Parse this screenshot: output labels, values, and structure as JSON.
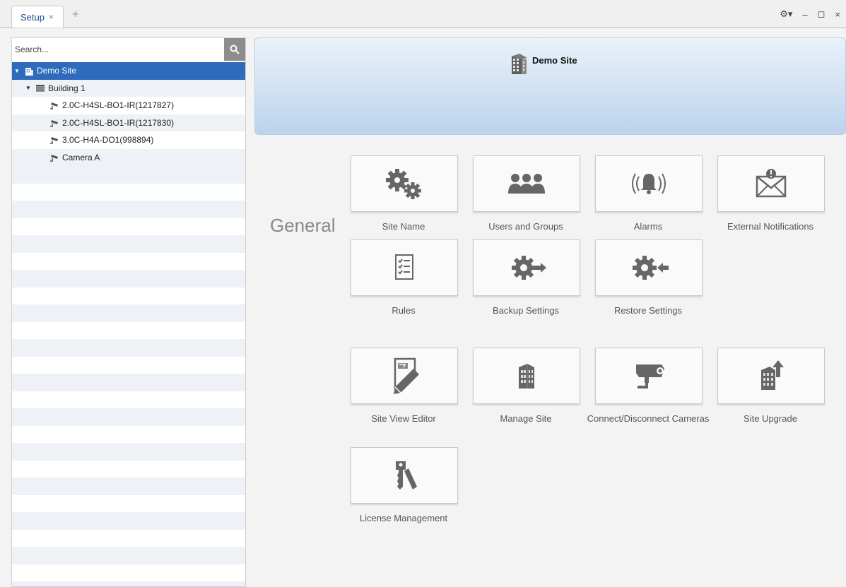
{
  "topbar": {
    "tab_label": "Setup",
    "tab_close": "×",
    "add_tab": "+",
    "settings_glyph": "⚙▾",
    "minimize": "–",
    "maximize": "◻",
    "close": "×"
  },
  "sidebar": {
    "search_placeholder": "Search...",
    "tree": [
      {
        "label": "Demo Site",
        "icon": "building-icon",
        "level": 0,
        "selected": true,
        "expanded": true
      },
      {
        "label": "Building 1",
        "icon": "building-floors-icon",
        "level": 1,
        "selected": false,
        "expanded": true
      },
      {
        "label": "2.0C-H4SL-BO1-IR(1217827)",
        "icon": "camera-icon",
        "level": 2
      },
      {
        "label": "2.0C-H4SL-BO1-IR(1217830)",
        "icon": "camera-icon",
        "level": 2
      },
      {
        "label": "3.0C-H4A-DO1(998894)",
        "icon": "camera-icon",
        "level": 2
      },
      {
        "label": "Camera A",
        "icon": "camera-icon",
        "level": 2
      }
    ]
  },
  "banner": {
    "title": "Demo Site",
    "icon": "building-icon"
  },
  "general": {
    "section_label": "General",
    "tiles": [
      {
        "label": "Site Name",
        "icon": "gears-icon"
      },
      {
        "label": "Users and Groups",
        "icon": "users-icon"
      },
      {
        "label": "Alarms",
        "icon": "alarm-bell-icon"
      },
      {
        "label": "External Notifications",
        "icon": "envelope-icon"
      },
      {
        "label": "Rules",
        "icon": "checklist-icon"
      },
      {
        "label": "Backup Settings",
        "icon": "gear-export-icon"
      },
      {
        "label": "Restore Settings",
        "icon": "gear-import-icon"
      },
      {
        "label": "Site View Editor",
        "icon": "map-pencil-icon"
      },
      {
        "label": "Manage Site",
        "icon": "building-icon"
      },
      {
        "label": "Connect/Disconnect Cameras",
        "icon": "security-camera-icon"
      },
      {
        "label": "Site Upgrade",
        "icon": "building-upgrade-icon"
      },
      {
        "label": "License Management",
        "icon": "keys-icon"
      }
    ]
  },
  "colors": {
    "selection": "#2f6bbd",
    "banner_top": "#eaf2fb",
    "banner_bottom": "#bcd3ec",
    "icon_gray": "#6a6a6a"
  }
}
